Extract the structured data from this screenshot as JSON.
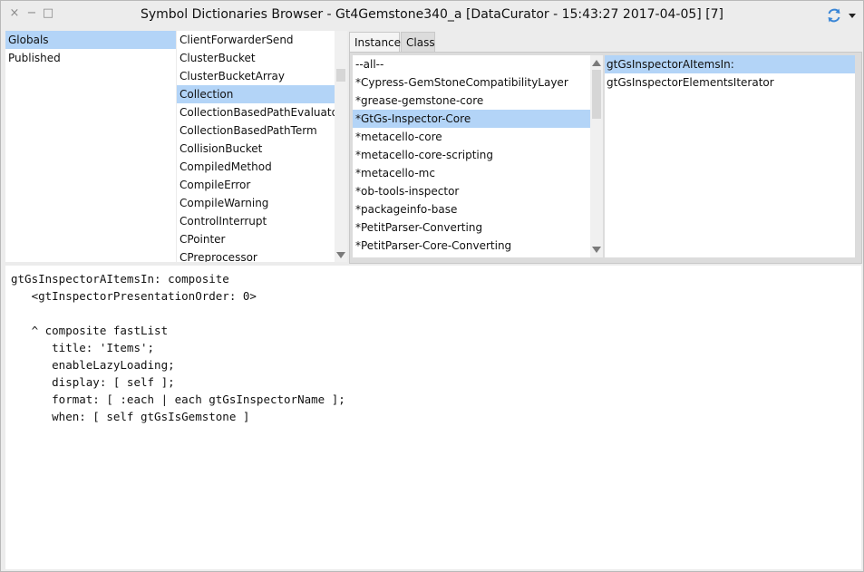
{
  "window": {
    "title": "Symbol Dictionaries Browser - Gt4Gemstone340_a [DataCurator - 15:43:27 2017-04-05] [7]",
    "close_glyph": "×",
    "minimize_glyph": "−",
    "maximize_glyph": "□"
  },
  "dictionaries": [
    {
      "label": "Globals",
      "selected": true
    },
    {
      "label": "Published",
      "selected": false
    }
  ],
  "classes": [
    {
      "label": "ClientForwarderSend",
      "selected": false
    },
    {
      "label": "ClusterBucket",
      "selected": false
    },
    {
      "label": "ClusterBucketArray",
      "selected": false
    },
    {
      "label": "Collection",
      "selected": true
    },
    {
      "label": "CollectionBasedPathEvaluator",
      "selected": false
    },
    {
      "label": "CollectionBasedPathTerm",
      "selected": false
    },
    {
      "label": "CollisionBucket",
      "selected": false
    },
    {
      "label": "CompiledMethod",
      "selected": false
    },
    {
      "label": "CompileError",
      "selected": false
    },
    {
      "label": "CompileWarning",
      "selected": false
    },
    {
      "label": "ControlInterrupt",
      "selected": false
    },
    {
      "label": "CPointer",
      "selected": false
    },
    {
      "label": "CPreprocessor",
      "selected": false
    }
  ],
  "tabs": [
    {
      "label": "Instance",
      "active": true
    },
    {
      "label": "Class",
      "active": false
    }
  ],
  "categories": [
    {
      "label": "--all--",
      "selected": false
    },
    {
      "label": "*Cypress-GemStoneCompatibilityLayer",
      "selected": false
    },
    {
      "label": "*grease-gemstone-core",
      "selected": false
    },
    {
      "label": "*GtGs-Inspector-Core",
      "selected": true
    },
    {
      "label": "*metacello-core",
      "selected": false
    },
    {
      "label": "*metacello-core-scripting",
      "selected": false
    },
    {
      "label": "*metacello-mc",
      "selected": false
    },
    {
      "label": "*ob-tools-inspector",
      "selected": false
    },
    {
      "label": "*packageinfo-base",
      "selected": false
    },
    {
      "label": "*PetitParser-Converting",
      "selected": false
    },
    {
      "label": "*PetitParser-Core-Converting",
      "selected": false
    }
  ],
  "methods": [
    {
      "label": "gtGsInspectorAItemsIn:",
      "selected": true
    },
    {
      "label": "gtGsInspectorElementsIterator",
      "selected": false
    }
  ],
  "source": {
    "lines": [
      "gtGsInspectorAItemsIn: composite",
      "   <gtInspectorPresentationOrder: 0>",
      "",
      "   ^ composite fastList",
      "      title: 'Items';",
      "      enableLazyLoading;",
      "      display: [ self ];",
      "      format: [ :each | each gtGsInspectorName ];",
      "      when: [ self gtGsIsGemstone ]"
    ]
  },
  "colors": {
    "selection": "#b3d4f7",
    "sync_icon": "#3a86d6"
  },
  "icons": {
    "close": "close-icon",
    "minimize": "minimize-icon",
    "maximize": "maximize-icon",
    "sync": "sync-icon",
    "menu": "chevron-down-icon"
  }
}
